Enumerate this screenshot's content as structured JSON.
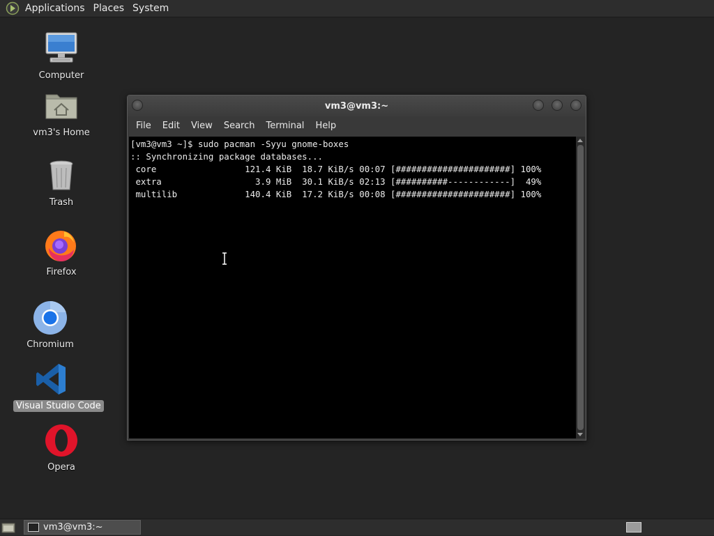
{
  "top_panel": {
    "menus": [
      "Applications",
      "Places",
      "System"
    ]
  },
  "desktop": {
    "icons": [
      {
        "label": "Computer",
        "icon": "computer-icon"
      },
      {
        "label": "vm3's Home",
        "icon": "home-folder-icon"
      },
      {
        "label": "Trash",
        "icon": "trash-icon"
      },
      {
        "label": "Firefox",
        "icon": "firefox-icon"
      },
      {
        "label": "Chromium",
        "icon": "chromium-icon"
      },
      {
        "label": "Visual Studio Code",
        "icon": "vscode-icon",
        "selected": true
      },
      {
        "label": "Opera",
        "icon": "opera-icon"
      }
    ]
  },
  "terminal": {
    "title": "vm3@vm3:~",
    "menu": [
      "File",
      "Edit",
      "View",
      "Search",
      "Terminal",
      "Help"
    ],
    "lines": [
      "[vm3@vm3 ~]$ sudo pacman -Syyu gnome-boxes",
      ":: Synchronizing package databases...",
      " core                 121.4 KiB  18.7 KiB/s 00:07 [######################] 100%",
      " extra                  3.9 MiB  30.1 KiB/s 02:13 [##########------------]  49%",
      " multilib             140.4 KiB  17.2 KiB/s 00:08 [######################] 100%"
    ]
  },
  "bottom_panel": {
    "task_label": "vm3@vm3:~"
  },
  "colors": {
    "desktop_bg": "#242424",
    "panel_bg": "#2d2d2d",
    "terminal_bg": "#000000",
    "selection": "#8a8a8a"
  }
}
